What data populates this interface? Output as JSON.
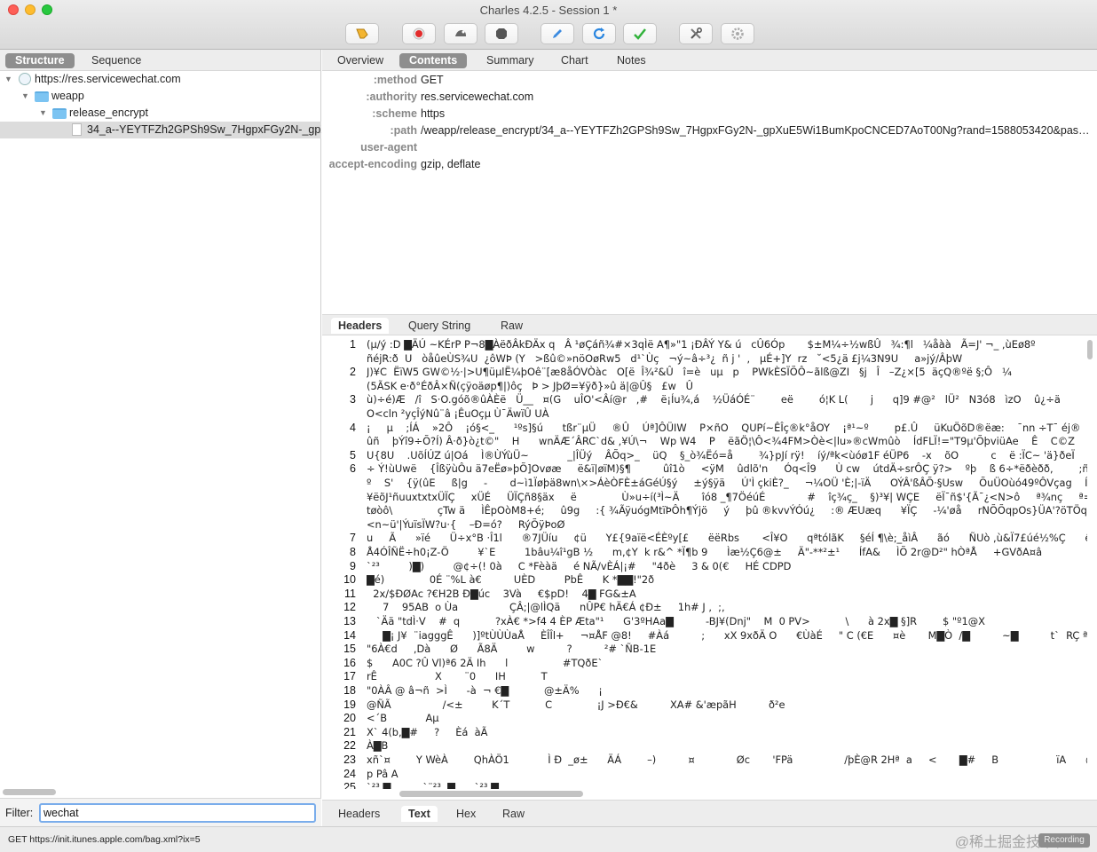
{
  "window": {
    "title": "Charles 4.2.5 - Session 1 *"
  },
  "toolbar": {
    "buttons": [
      "pen-icon",
      "record-icon",
      "throttle-icon",
      "stop-icon",
      "compose-icon",
      "repeat-icon",
      "validate-icon",
      "tools-icon",
      "settings-icon"
    ]
  },
  "left_tabs": [
    "Structure",
    "Sequence"
  ],
  "tree": [
    {
      "label": "https://res.servicewechat.com",
      "disclosure": "▼"
    },
    {
      "label": "weapp",
      "disclosure": "▼"
    },
    {
      "label": "release_encrypt",
      "disclosure": "▼"
    },
    {
      "label": "34_a--YEYTFZh2GPSh9Sw_7HgpxFGy2N-_gpX",
      "disclosure": ""
    }
  ],
  "filter": {
    "label": "Filter:",
    "value": "wechat"
  },
  "right_tabs": [
    "Overview",
    "Contents",
    "Summary",
    "Chart",
    "Notes"
  ],
  "headers": [
    {
      "key": ":method",
      "value": "GET"
    },
    {
      "key": ":authority",
      "value": "res.servicewechat.com"
    },
    {
      "key": ":scheme",
      "value": "https"
    },
    {
      "key": ":path",
      "value": "/weapp/release_encrypt/34_a--YEYTFZh2GPSh9Sw_7HgpxFGy2N-_gpXuE5Wi1BumKpoCNCED7AoT00Ng?rand=1588053420&pass_…"
    },
    {
      "key": "user-agent",
      "value": ""
    },
    {
      "key": "accept-encoding",
      "value": "gzip, deflate"
    }
  ],
  "request_tabs": [
    "Headers",
    "Query String",
    "Raw"
  ],
  "content_lines": [
    {
      "n": "1",
      "t": "(μ/ý :D ▇ÄÚ ~KÉrP P¬8▇ÀëðÂkÐÄx q   Â ¹øÇáñ¾#×3qÌë A¶»\"1 ¡ÐÂÝ Y& ú   cÛ6Óp       $±M¼÷½wßÛ   ¾:¶l   ¼åàà   Ã=J' ¬_ ,ùEø8º"
    },
    {
      "n": "",
      "t": "ñéjR:ð  U   òåûeÙS¾U  ¿ôWÞ (Y   >ßû©»nöOøRw5   d¹`Ùç   ¬ý~â÷³¿  ñ j '  ,   µÉ+]Y  rz   ˘<5¿ä £j¼3N9U     a»jý/ÂþW"
    },
    {
      "n": "2",
      "t": "J)¥C  ËïW5 GW©½·|>U¶üµlË¼þOê¨[æ8åÓVÒàc   O[ë  Î¾²&Û   î=è   uµ   p    PWkÈSÏÕÔ~ãlß@ZI   §j   Î   –Z¿×[5  äçQ®ºë §;Ô   ¼"
    },
    {
      "n": "",
      "t": "(5ÃSK e·ð°ÉðÂ×Ñ(çÿoäøp¶|)ôç   Þ > JþØ=¥ÿð}»û ä|@Û§   £w   Û"
    },
    {
      "n": "3",
      "t": "ù)÷é)Æ   /î   S·O.góõ®ûÀÈë   Ü__   ¤(G    uÎO'<Âí@r   ,#    ë¡Íu¾,á    ½ÜáÓÉ¨        eë        ó¦K L(       j      q]9 #@²   lÜ²   N3ó8   ìzO    û¿÷ä"
    },
    {
      "n": "",
      "t": "O<cln ²yçÎýNû¨â ¡ÊuOçµ Ù¯ÄwïÛ UÀ"
    },
    {
      "n": "4",
      "t": "¡     µ    ;ÍÁ    »2Ô    ¡ó§<_      ¹ºs]§ú      tßr¨µÜ     ®Û    Úª]ÔÜIW    P×ñO    QUPí~ÊÎç®k°åOY    ¡ª¹~º        p£.Û     üKuÖõD®ëæ:    ¯nn ÷T¯ éj®"
    },
    {
      "n": "",
      "t": "ûñ    þÝî9÷Õ?Í) Â·ð}ò¿t©\"    H      wnÄÆ´ÂRC`d& ,¥Ú\\¬    Wp W4    P    ëãÖ¦\\Ô<¾4FM>Òè<|lu»®cWmûò    ÍdFLÏ!=\"T9µ'ÕþviüAe    Ê    C©Z"
    },
    {
      "n": "5",
      "t": "U{8U    .UõÍÚZ ú|Oá    Ì®ÙÝùÜ~            _|ÎÜý    ÂÕq>_    üQ    §_ò¾Ëó=å        ¾}pJí rÿ!    íý/ªk<ùóø1F éÜP6    -x    õO          c    ë :ÏC~ 'ä}ðeÏ"
    },
    {
      "n": "6",
      "t": "÷ Ý!ùUwë    {ÎßÿùÔu ä7eËø»þÕ]Ovøæ     ë&ï|øïM)§¶          ûî1ò     <ÿM    ûdlõ'n     Óq<Î9      Ù cw    útdÄ÷srÔÇ ÿ?>    ºþ    ß 6÷*ëðèðð,        ;ñ"
    },
    {
      "n": "",
      "t": "º    S'    {ÿ(ûE     ß|g     -       d~ì1Ïøþä8wn\\×>ÁèÒFÈ±áGéÚ§ý     ±ý§ÿä     Ú'Ì çkiÈ?_     ¬¼OÜ 'È;|-ïÄ      OÝÂ'ßÂÕ·§Usw     ÕuÜOùó49ºÔVçag    Í"
    },
    {
      "n": "",
      "t": "¥ëõJ¹ñuuxtxtxÜÏÇ     xÜÉ     ÜÏÇñ8§äx     ë              Ù»u÷í(³Ì~Ä       îó8 _¶7ÖéúÉ             #    îç¾ç_    §)³¥| WÇE     ëÏ¯ñ$'{Ã¯¿<N>ô     ª¾nç     ª="
    },
    {
      "n": "",
      "t": "tøòô\\              çTw ä     ÌÊpOòM8+é;     û9g     :{ ¾ÃÿuógMtïÞÔh¶Ýjö     ý     þû ®kvvÝÓú¿     :® ÆUæq      ¥ÏÇ     -¼'øå     rNÕÕqpOs}ÜA'?öTÖq"
    },
    {
      "n": "",
      "t": "<n~ü'|ÝuïsÏW?u·{    –Ð=ó?     RýÕÿÞoØ"
    },
    {
      "n": "7",
      "t": "u     Ã      »ïé      Ü÷x°B ·Î1l      ®7JÜíu     ¢ü      Y£{9aïë<ÉÈºy[£      ëëRbs       <Î¥O      qªtólãK     §éÍ ¶\\è;_åìÂ      ãó      ÑUò ,ù&Ï7£úé½%Ç      ê<Ï{á      ï)<}w"
    },
    {
      "n": "8",
      "t": "Å4ÓÎÑË÷h0¡Z-Ö         ¥`E         1bâu¼î¹gB ½      m,¢Y  k r&^ *Ï¶b 9      Ìæ½Ç6@±     Ä\"-**²±¹      ÍfA&     ÌÕ 2r@D²\" hÒªÅ     +GVðA¤â                0"
    },
    {
      "n": "9",
      "t": "`²³         )▇)         @¢÷(! 0à     C *Fèàä     é NÃ/vÈÁ|¡#     \"4ðè     3 & 0(€     HÉ CDPD"
    },
    {
      "n": "10",
      "t": "▇é)              0É ¨%L à€          UÈD         PbÊ      K *▇▇!\"2ð"
    },
    {
      "n": "11",
      "t": "  2x/$ÐØAc ?€H2B Ð▇úc    3Và     €$pD!    4▇ FG&±A"
    },
    {
      "n": "12",
      "t": "     7    95AB  o Ùa                ÇÂ;|@lÌQä      nÛP€ hÄ€Á ¢Ð±     1h# J ,  ;,"
    },
    {
      "n": "13",
      "t": "   `Ää \"tdÌ·V    #  q           ?xÀ€ *>f4 4 ÈP Æta\"¹      G'3ºHAa▇          -BJ¥(Dnj\"    M  0 PV>           \\      à 2x▇ §]R        $ \"º1@X"
    },
    {
      "n": "14",
      "t": "     ▇¡ J¥  ¨iagggÊ      )]ºtÙÙÙaÅ     ÈÎÎl+     ¬¤ÅF @8!     #Àá          ;      xX 9xðÄ O      €ÙàÉ     \" C (€E      ¤è       M▇Ò  /▇          ~▇          t`  RÇ ª  Paå"
    },
    {
      "n": "15",
      "t": "\"6À€d     ,Dà      Ø      Ã8Ä         w          ?          ²# `ÑB-1E"
    },
    {
      "n": "16",
      "t": "$      A0C ?Û Vl)ª6 2Ä Ih      l                 #TQðE`"
    },
    {
      "n": "17",
      "t": "rÊ                  X       ¨0      IH           T"
    },
    {
      "n": "18",
      "t": "\"0ÀÂ @ â¬ñ  >Ì      -à  ¬ €▇           @±Ä%      ¡"
    },
    {
      "n": "19",
      "t": "@ÑÃ                /<±         K´T           C              ¡J >Ð€&          XA# &'æpãH          ð²e"
    },
    {
      "n": "20",
      "t": "<´B            Aµ"
    },
    {
      "n": "21",
      "t": "X` 4(b,▇#     ?     Èá  àÃ"
    },
    {
      "n": "22",
      "t": "À▇B"
    },
    {
      "n": "23",
      "t": "xñ`¤        Y WèÀ        QhÀÖ1            Ì Ð  _ø±      ÄÁ        –)          ¤             Øc       'FPä                /þÈ@R 2Hª  a     <       ▇#     B                  ïA      @n                 %d▇¨€          ´0BÓ"
    },
    {
      "n": "24",
      "t": "p Pâ A"
    },
    {
      "n": "25",
      "t": "`²³ ▇          `¨²³  ▇      `²³ ▇"
    }
  ],
  "response_tabs": [
    "Headers",
    "Text",
    "Hex",
    "Raw"
  ],
  "status": {
    "text": "GET https://init.itunes.apple.com/bag.xml?ix=5",
    "badge": "Recording",
    "watermark": "@稀土掘金技术社区"
  }
}
